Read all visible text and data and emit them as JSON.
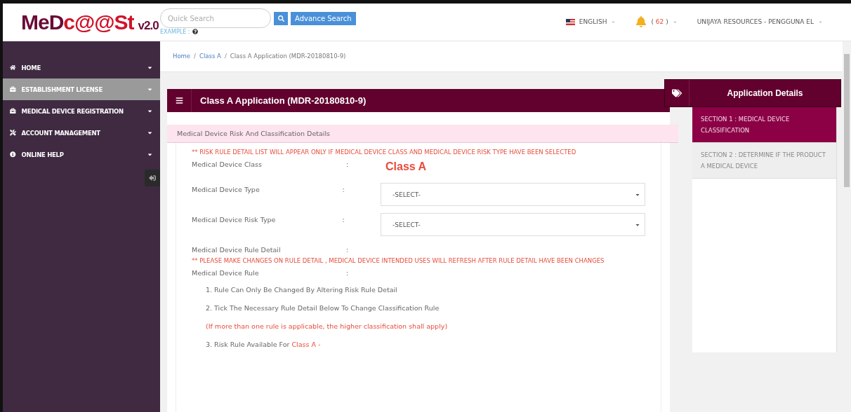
{
  "logo": {
    "parts": [
      "MeD",
      "c@@St"
    ],
    "version": "v2.0"
  },
  "search": {
    "placeholder": "Quick Search",
    "advance_button": "Advance Search",
    "example_label": "EXAMPLE :"
  },
  "topbar": {
    "language": "ENGLISH",
    "notification_open": "(",
    "notification_count": "62",
    "notification_close": ")",
    "user": "UNIJAYA RESOURCES - PENGGUNA EL"
  },
  "sidebar": {
    "items": [
      {
        "label": "HOME",
        "selected": false
      },
      {
        "label": "ESTABLISHMENT LICENSE",
        "selected": true
      },
      {
        "label": "MEDICAL DEVICE REGISTRATION",
        "selected": false
      },
      {
        "label": "ACCOUNT MANAGEMENT",
        "selected": false
      },
      {
        "label": "ONLINE HELP",
        "selected": false
      }
    ]
  },
  "breadcrumb": [
    {
      "label": "Home",
      "link": true
    },
    {
      "separator": "/"
    },
    {
      "label": "Class A",
      "link": true
    },
    {
      "separator": "/"
    },
    {
      "label": "Class A Application (MDR-20180810-9)",
      "link": false
    }
  ],
  "panel": {
    "title": "Class A Application (MDR-20180810-9)",
    "section_title": "Medical Device Risk And Classification Details",
    "warning_top": "** RISK RULE DETAIL LIST WILL APPEAR ONLY IF MEDICAL DEVICE CLASS AND MEDICAL DEVICE RISK TYPE HAVE BEEN SELECTED",
    "fields": [
      {
        "label": "Medical Device Class",
        "colon": ":",
        "kind": "value",
        "value": "Class A"
      },
      {
        "label": "Medical Device Type",
        "colon": ":",
        "kind": "select",
        "value": "-SELECT-"
      },
      {
        "label": "Medical Device Risk Type",
        "colon": ":",
        "kind": "select",
        "value": "-SELECT-"
      },
      {
        "label": "Medical Device Rule Detail",
        "colon": ":",
        "kind": "empty"
      }
    ],
    "warning_rule": "** PLEASE MAKE CHANGES ON RULE DETAIL , MEDICAL DEVICE INTENDED USES WILL REFRESH AFTER RULE DETAIL HAVE BEEN CHANGES",
    "rule_label": "Medical Device Rule",
    "rule_colon": ":",
    "rules": [
      {
        "kind": "rule",
        "text": "1. Rule Can Only Be Changed By Altering Risk Rule Detail"
      },
      {
        "kind": "rule",
        "text": "2. Tick The Necessary Rule Detail Below To Change Classification Rule"
      },
      {
        "kind": "note",
        "text": "(If more than one rule is applicable, the higher classification shall apply)"
      },
      {
        "kind": "rule",
        "text": "3. Risk Rule Available For",
        "highlight": "Class A -"
      }
    ]
  },
  "details": {
    "title": "Application Details",
    "sections": [
      {
        "label": "SECTION 1 : MEDICAL DEVICE CLASSIFICATION",
        "selected": true
      },
      {
        "label": "SECTION 2 : DETERMINE IF THE PRODUCT A MEDICAL DEVICE",
        "selected": false
      }
    ]
  }
}
